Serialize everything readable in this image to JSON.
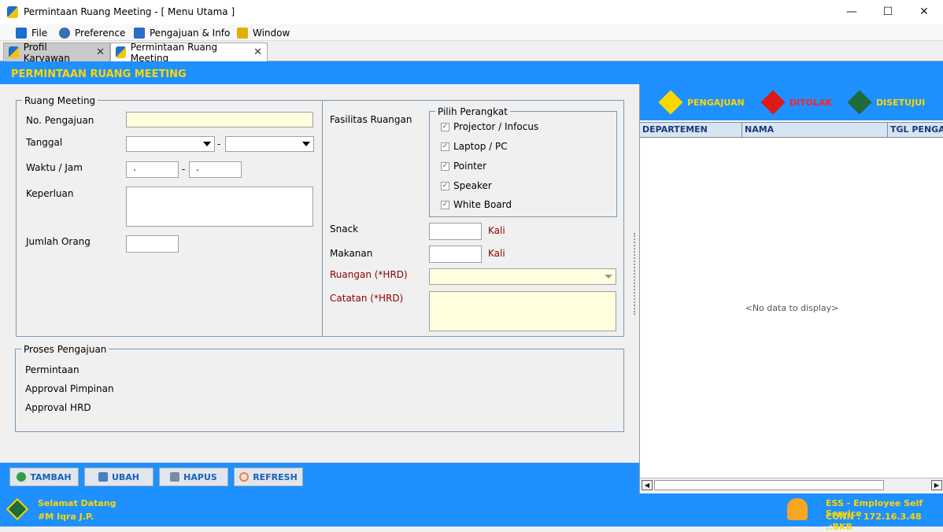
{
  "window": {
    "title": "Permintaan Ruang Meeting - [ Menu Utama ]"
  },
  "menu": [
    {
      "label": "File",
      "icon": "folder-icon",
      "color": "#1a6fd1"
    },
    {
      "label": "Preference",
      "icon": "gear-icon",
      "color": "#3a6fb0"
    },
    {
      "label": "Pengajuan & Info",
      "icon": "document-edit-icon",
      "color": "#2b6cc4"
    },
    {
      "label": "Window",
      "icon": "window-icon",
      "color": "#e0b000"
    }
  ],
  "tabs": [
    {
      "label": "Profil Karyawan",
      "active": false
    },
    {
      "label": "Permintaan Ruang Meeting",
      "active": true
    }
  ],
  "header": {
    "title": "PERMINTAAN RUANG MEETING"
  },
  "form": {
    "group_ruang": "Ruang Meeting",
    "no_pengajuan": "No. Pengajuan",
    "tanggal": "Tanggal",
    "waktu_jam": "Waktu / Jam",
    "time_placeholder": ".",
    "dash": "-",
    "keperluan": "Keperluan",
    "jumlah_orang": "Jumlah Orang",
    "fasilitas": "Fasilitas Ruangan",
    "group_perangkat": "Pilih Perangkat",
    "devices": [
      "Projector / Infocus",
      "Laptop / PC",
      "Pointer",
      "Speaker",
      "White Board"
    ],
    "snack": "Snack",
    "makanan": "Makanan",
    "kali": "Kali",
    "ruangan_hrd": "Ruangan (*HRD)",
    "catatan_hrd": "Catatan (*HRD)",
    "group_proses": "Proses Pengajuan",
    "proses": [
      "Permintaan",
      "Approval Pimpinan",
      "Approval HRD"
    ]
  },
  "buttons": {
    "tambah": "TAMBAH",
    "ubah": "UBAH",
    "hapus": "HAPUS",
    "refresh": "REFRESH"
  },
  "status": {
    "pengajuan": "PENGAJUAN",
    "ditolak": "DITOLAK",
    "disetujui": "DISETUJUI"
  },
  "grid": {
    "columns": [
      "DEPARTEMEN",
      "NAMA",
      "TGL PENGAJ"
    ],
    "empty": "<No data to display>"
  },
  "footer": {
    "welcome": "Selamat Datang",
    "user": "#M Iqra J.P.",
    "app": "ESS - Employee Self Service",
    "conn": "CONN : 172.16.3.48 .:BKB"
  },
  "colors": {
    "accent": "#1e90ff",
    "title_text": "#ffd700",
    "hrd_label": "#8b0000"
  }
}
